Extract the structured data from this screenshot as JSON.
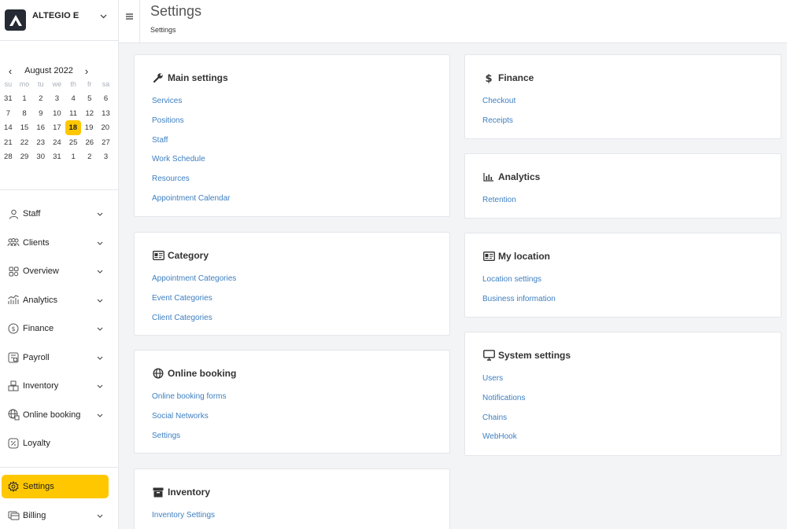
{
  "brand": {
    "name": "ALTEGIO E"
  },
  "calendar": {
    "month": "August 2022",
    "weekdays": [
      "su",
      "mo",
      "tu",
      "we",
      "th",
      "fr",
      "sa"
    ],
    "weeks": [
      [
        "31",
        "1",
        "2",
        "3",
        "4",
        "5",
        "6"
      ],
      [
        "7",
        "8",
        "9",
        "10",
        "11",
        "12",
        "13"
      ],
      [
        "14",
        "15",
        "16",
        "17",
        "18",
        "19",
        "20"
      ],
      [
        "21",
        "22",
        "23",
        "24",
        "25",
        "26",
        "27"
      ],
      [
        "28",
        "29",
        "30",
        "31",
        "1",
        "2",
        "3"
      ]
    ],
    "selected": "18"
  },
  "sidebar": {
    "items": [
      {
        "label": "Staff",
        "icon": "person-icon"
      },
      {
        "label": "Clients",
        "icon": "clients-icon"
      },
      {
        "label": "Overview",
        "icon": "overview-icon"
      },
      {
        "label": "Analytics",
        "icon": "analytics-icon"
      },
      {
        "label": "Finance",
        "icon": "finance-icon"
      },
      {
        "label": "Payroll",
        "icon": "payroll-icon"
      },
      {
        "label": "Inventory",
        "icon": "inventory-icon"
      },
      {
        "label": "Online booking",
        "icon": "online-booking-icon"
      },
      {
        "label": "Loyalty",
        "icon": "loyalty-icon"
      }
    ],
    "settings": {
      "label": "Settings",
      "icon": "gear-icon"
    },
    "billing": {
      "label": "Billing",
      "icon": "billing-icon"
    }
  },
  "header": {
    "title": "Settings",
    "breadcrumb": "Settings"
  },
  "cards": {
    "main_settings": {
      "title": "Main settings",
      "icon": "wrench-icon",
      "links": [
        "Services",
        "Positions",
        "Staff",
        "Work Schedule",
        "Resources",
        "Appointment Calendar"
      ]
    },
    "category": {
      "title": "Category",
      "icon": "id-card-icon",
      "links": [
        "Appointment Categories",
        "Event Categories",
        "Client Categories"
      ]
    },
    "online_booking": {
      "title": "Online booking",
      "icon": "globe-icon",
      "links": [
        "Online booking forms",
        "Social Networks",
        "Settings"
      ]
    },
    "inventory": {
      "title": "Inventory",
      "icon": "archive-icon",
      "links": [
        "Inventory Settings"
      ]
    },
    "finance": {
      "title": "Finance",
      "icon": "dollar-icon",
      "links": [
        "Checkout",
        "Receipts"
      ]
    },
    "analytics": {
      "title": "Analytics",
      "icon": "bar-chart-icon",
      "links": [
        "Retention"
      ]
    },
    "my_location": {
      "title": "My location",
      "icon": "id-card-icon",
      "links": [
        "Location settings",
        "Business information"
      ]
    },
    "system_settings": {
      "title": "System settings",
      "icon": "monitor-icon",
      "links": [
        "Users",
        "Notifications",
        "Chains",
        "WebHook"
      ]
    }
  },
  "colors": {
    "accent": "#ffc700",
    "link": "#3d7fc1",
    "logo_bg": "#252a34"
  }
}
